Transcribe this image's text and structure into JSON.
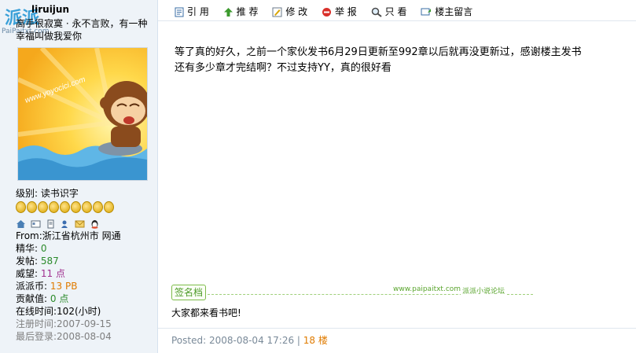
{
  "site": {
    "logo_text": "派派",
    "logo_sub": "PaiPaitxt.com"
  },
  "profile": {
    "username": "liruijun",
    "signature": "高手很寂寞 · 永不言败，有一种幸福叫做我爱你",
    "level_label": "级别:",
    "level_value": "读书识字",
    "medal_count": 9,
    "from": "From:浙江省杭州市 网通",
    "stats": {
      "jinghua_label": "精华:",
      "jinghua": "0",
      "posts_label": "发帖:",
      "posts": "587",
      "prestige_label": "威望:",
      "prestige": "11 点",
      "coins_label": "派派币:",
      "coins": "13 PB",
      "contrib_label": "贡献值:",
      "contrib": "0 点",
      "online": "在线时间:102(小时)",
      "registered": "注册时间:2007-09-15",
      "last_login": "最后登录:2008-08-04"
    },
    "avatar_text": "www.yoyocici.com"
  },
  "toolbar": {
    "quote": "引 用",
    "recommend": "推 荐",
    "edit": "修 改",
    "report": "举 报",
    "only_view": "只 看",
    "owner_msg": "楼主留言"
  },
  "post": {
    "body_line1": "等了真的好久，之前一个家伙发书6月29日更新至992章以后就再没更新过，感谢楼主发书",
    "body_line2": "还有多少章才完结啊？不过支持YY，真的很好看"
  },
  "signature_block": {
    "tag": "签名档",
    "site_url": "www.paipaitxt.com",
    "forum_name": "派派小说论坛",
    "text": "大家都来看书吧!"
  },
  "footer": {
    "posted": "Posted: 2008-08-04 17:26 |",
    "floor": "18 楼"
  },
  "colors": {
    "accent_green": "#2a8a2a",
    "accent_orange": "#e07b00",
    "panel_bg": "#eef3f8"
  }
}
